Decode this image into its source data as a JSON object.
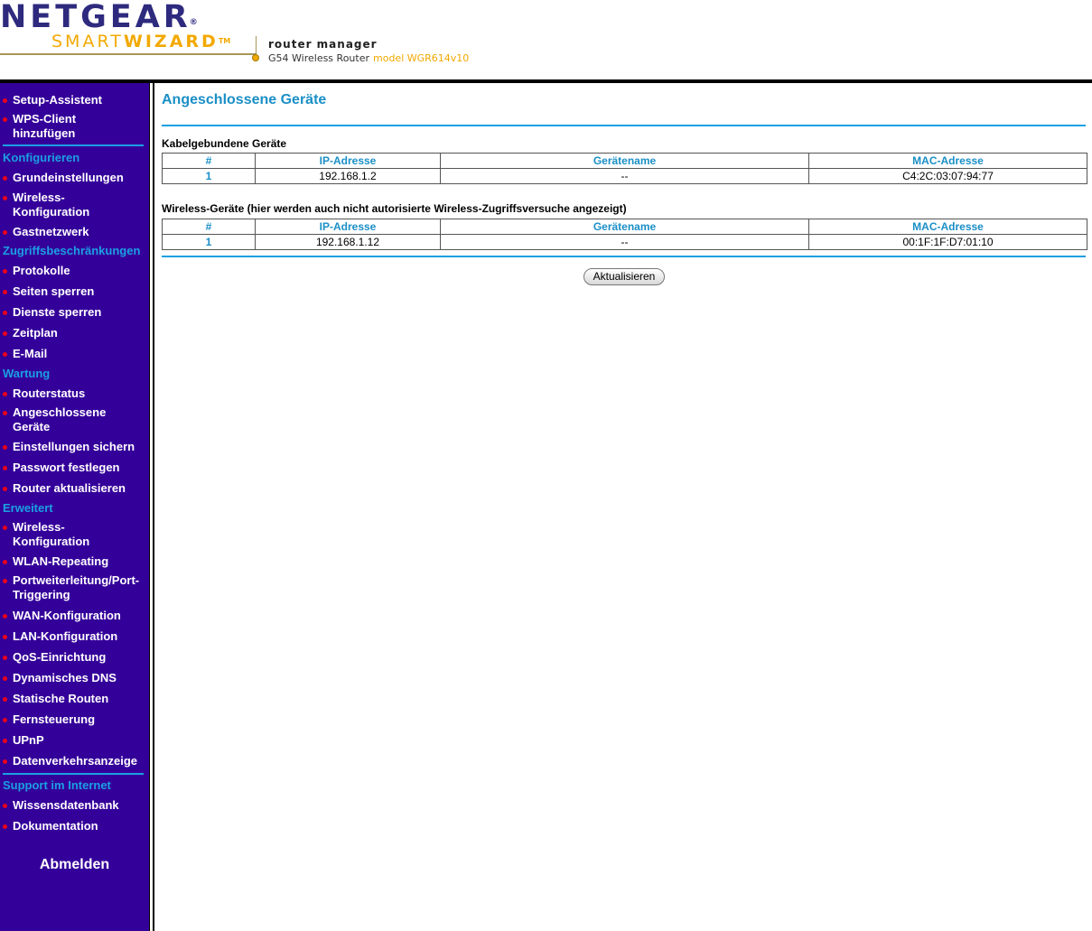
{
  "header": {
    "brand": "NETGEAR",
    "product_light": "SMART",
    "product_bold": "WIZARD",
    "tm": "TM",
    "app_title": "router manager",
    "device": "G54 Wireless Router",
    "model": "model WGR614v10",
    "colors": {
      "brand": "#2e2a7e",
      "accent": "#f2a900"
    }
  },
  "sidebar": {
    "bg_color": "#34009a",
    "items": {
      "setup_assistant": "Setup-Assistent",
      "wps_client": "WPS-Client hinzufügen",
      "h_configure": "Konfigurieren",
      "basic_settings": "Grundeinstellungen",
      "wireless_config": "Wireless-Konfiguration",
      "guest_network": "Gastnetzwerk",
      "h_access": "Zugriffsbeschränkungen",
      "logs": "Protokolle",
      "block_sites": "Seiten sperren",
      "block_services": "Dienste sperren",
      "schedule": "Zeitplan",
      "email": "E-Mail",
      "h_maintenance": "Wartung",
      "router_status": "Routerstatus",
      "attached_devices": "Angeschlossene Geräte",
      "backup_settings": "Einstellungen sichern",
      "set_password": "Passwort festlegen",
      "router_upgrade": "Router aktualisieren",
      "h_advanced": "Erweitert",
      "adv_wireless_config": "Wireless-Konfiguration",
      "wlan_repeating": "WLAN-Repeating",
      "port_forwarding": "Portweiterleitung/Port-Triggering",
      "wan_config": "WAN-Konfiguration",
      "lan_config": "LAN-Konfiguration",
      "qos": "QoS-Einrichtung",
      "ddns": "Dynamisches DNS",
      "static_routes": "Statische Routen",
      "remote_mgmt": "Fernsteuerung",
      "upnp": "UPnP",
      "traffic_meter": "Datenverkehrsanzeige",
      "h_support": "Support im Internet",
      "knowledge_base": "Wissensdatenbank",
      "documentation": "Dokumentation",
      "logout": "Abmelden"
    }
  },
  "main": {
    "title": "Angeschlossene Geräte",
    "columns": {
      "idx": "#",
      "ip": "IP-Adresse",
      "name": "Gerätename",
      "mac": "MAC-Adresse"
    },
    "wired": {
      "title": "Kabelgebundene Geräte",
      "rows": [
        {
          "idx": "1",
          "ip": "192.168.1.2",
          "name": "--",
          "mac": "C4:2C:03:07:94:77"
        }
      ]
    },
    "wireless": {
      "title": "Wireless-Geräte (hier werden auch nicht autorisierte Wireless-Zugriffsversuche angezeigt)",
      "rows": [
        {
          "idx": "1",
          "ip": "192.168.1.12",
          "name": "--",
          "mac": "00:1F:1F:D7:01:10"
        }
      ]
    },
    "refresh_label": "Aktualisieren",
    "accent_color": "#1ba0e2"
  }
}
